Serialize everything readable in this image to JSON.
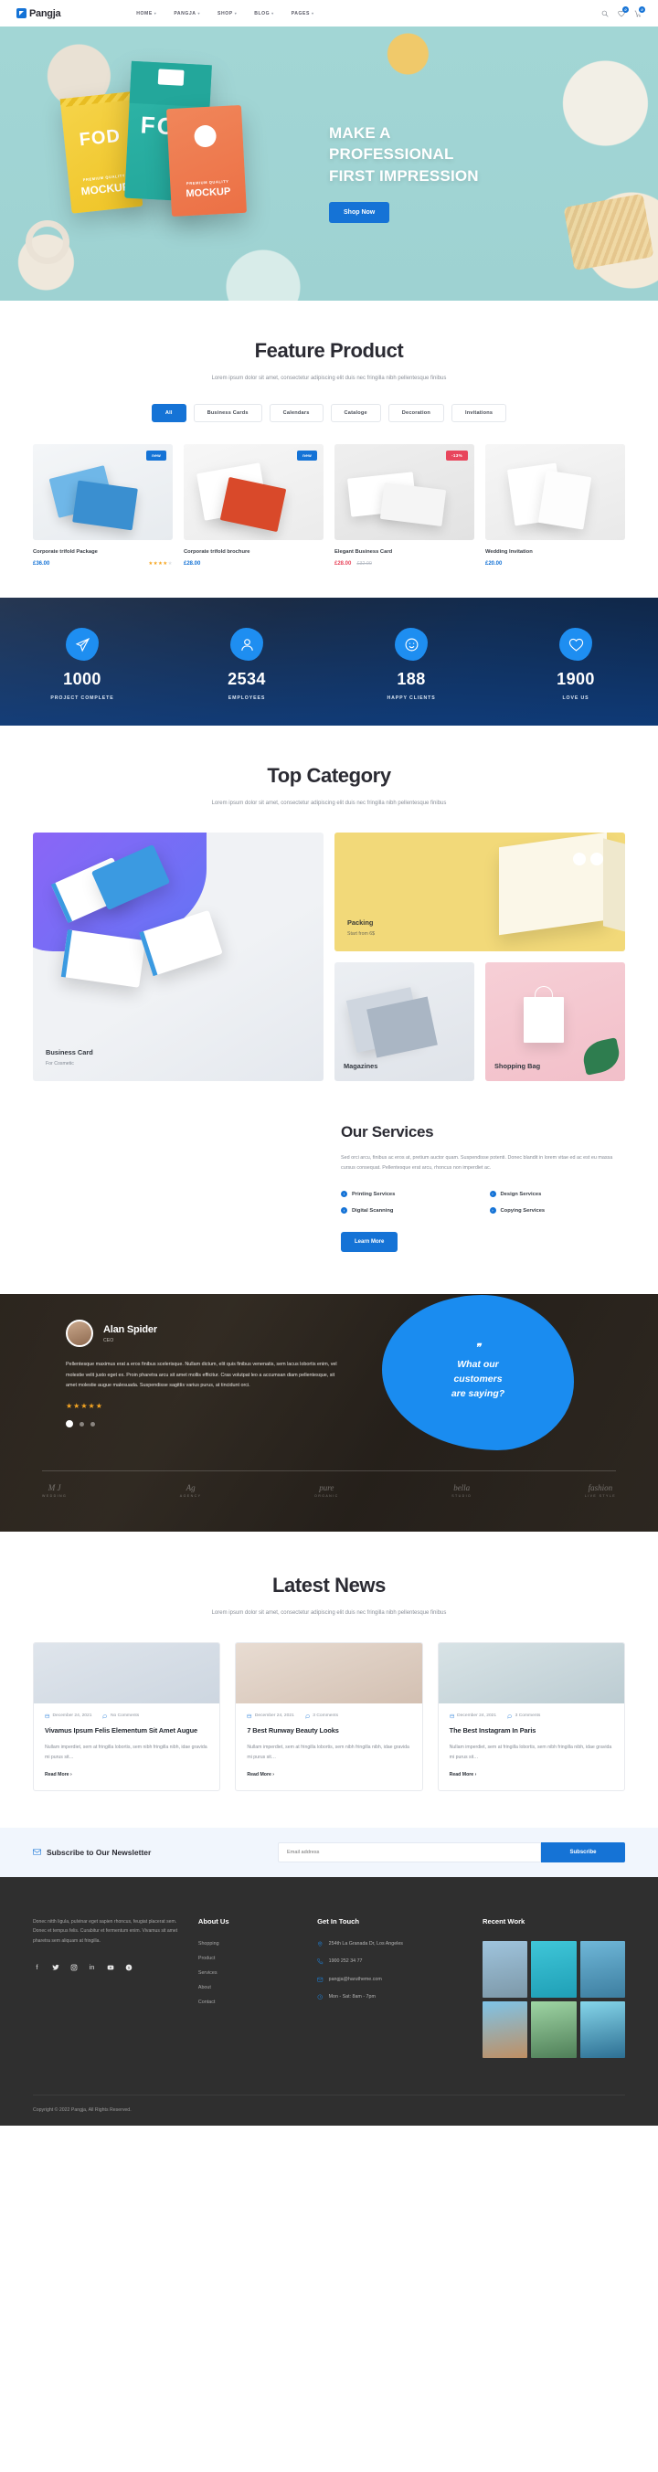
{
  "header": {
    "brand": "Pangja",
    "nav": [
      {
        "label": "HOME",
        "caret": "▾"
      },
      {
        "label": "PANGJA",
        "caret": "▾"
      },
      {
        "label": "SHOP",
        "caret": "▾"
      },
      {
        "label": "BLOG",
        "caret": "▾"
      },
      {
        "label": "PAGES",
        "caret": "▾"
      }
    ],
    "icons": {
      "search": "search-icon",
      "wishlist": "heart-icon",
      "wishlist_count": "0",
      "cart": "cart-icon",
      "cart_count": "0"
    }
  },
  "hero": {
    "line1": "MAKE A",
    "line2": "PROFESSIONAL",
    "line3": "FIRST IMPRESSION",
    "cta": "Shop Now",
    "pack_left_label": "MOCKUP",
    "pack_left_sub": "PREMIUM QUALITY",
    "pack_left_word": "FOD",
    "pack_mid_word": "FOD",
    "pack_right_label": "MOCKUP",
    "pack_right_sub": "PREMIUM QUALITY"
  },
  "feature": {
    "title": "Feature Product",
    "subtitle": "Lorem ipsum dolor sit amet, consectetur adipiscing elit duis nec fringilla nibh pellentesque finibus",
    "filters": [
      "All",
      "Business Cards",
      "Calendars",
      "Cataloge",
      "Decoration",
      "Invitations"
    ],
    "active_filter": "All",
    "products": [
      {
        "name": "Corporate trifold Package",
        "price": "£36.00",
        "old_price": "",
        "badge": "new",
        "badge_type": "new",
        "rating": 4,
        "show_stars": true
      },
      {
        "name": "Corporate trifold brochure",
        "price": "£28.00",
        "old_price": "",
        "badge": "new",
        "badge_type": "new",
        "rating": 0,
        "show_stars": false
      },
      {
        "name": "Elegant Business Card",
        "price": "£28.00",
        "old_price": "£32.00",
        "badge": "-13%",
        "badge_type": "sale",
        "rating": 0,
        "show_stars": false
      },
      {
        "name": "Wedding Invitation",
        "price": "£20.00",
        "old_price": "",
        "badge": "",
        "badge_type": "",
        "rating": 0,
        "show_stars": false
      }
    ]
  },
  "counters": [
    {
      "icon": "plane-icon",
      "value": "1000",
      "label": "PROJECT COMPLETE"
    },
    {
      "icon": "user-icon",
      "value": "2534",
      "label": "EMPLOYEES"
    },
    {
      "icon": "smile-icon",
      "value": "188",
      "label": "HAPPY CLIENTS"
    },
    {
      "icon": "heart-icon",
      "value": "1900",
      "label": "LOVE US"
    }
  ],
  "category": {
    "title": "Top Category",
    "subtitle": "Lorem ipsum dolor sit amet, consectetur adipiscing elit duis nec fringilla nibh pellentesque finibus",
    "cards": [
      {
        "title": "Business Card",
        "sub": "For Cosmetic"
      },
      {
        "title": "Packing",
        "sub": "Start from 6$"
      },
      {
        "title": "Magazines",
        "sub": ""
      },
      {
        "title": "Shopping Bag",
        "sub": ""
      }
    ]
  },
  "services": {
    "title": "Our Services",
    "paragraph": "Sed orci arcu, finibus ac eros at, pretium auctor quam. Suspendisse potenti. Donec blandit in lorem vitae ed ac est eu massa cursus consequat. Pellentesque erat arcu, rhoncus non imperdiet ac.",
    "items": [
      "Printing Services",
      "Design Services",
      "Digital Scanning",
      "Copying Services"
    ],
    "cta": "Learn More"
  },
  "testimonial": {
    "name": "Alan Spider",
    "role": "CEO",
    "text": "Pellentesque maximus erat a eros finibus scelerisque. Nullam dictum, elit quis finibus venenatis, sem lacus lobortis enim, vel molestie velit justo eget ex. Proin pharetra arcu sit amet mollis efficitur. Cras volutpat leo a accumsan diam pellentesque, sit amet molestie augue malesuada. Suspendisse sagittis varius purus, at tincidunt orci.",
    "stars": "★★★★★",
    "quote_mark": "\"",
    "blob_line1": "What our",
    "blob_line2": "customers",
    "blob_line3": "are saying?",
    "brands": [
      {
        "main": "M J",
        "sub": "WEDDING"
      },
      {
        "main": "Ag",
        "sub": "AGENCY"
      },
      {
        "main": "pure",
        "sub": "ORGANIC"
      },
      {
        "main": "bella",
        "sub": "STUDIO"
      },
      {
        "main": "fashion",
        "sub": "LIVE STYLE"
      }
    ]
  },
  "news": {
    "title": "Latest News",
    "subtitle": "Lorem ipsum dolor sit amet, consectetur adipiscing elit duis nec fringilla nibh pellentesque finibus",
    "posts": [
      {
        "date": "December 24, 2021",
        "comments": "No Comments",
        "title": "Vivamus Ipsum Felis Elementum Sit Amet Augue",
        "excerpt": "Nullam imperdiet, sem at fringilla lobortis, sem nibh fringilla nibh, idae gravida mi purus sit…",
        "more": "Read More ›"
      },
      {
        "date": "December 24, 2021",
        "comments": "3 Comments",
        "title": "7 Best Runway Beauty Looks",
        "excerpt": "Nullam imperdiet, sem at fringilla lobortis, sem nibh fringilla nibh, idae gravida mi purus sit…",
        "more": "Read More ›"
      },
      {
        "date": "December 24, 2021",
        "comments": "3 Comments",
        "title": "The Best Instagram In Paris",
        "excerpt": "Nullam imperdiet, sem at fringilla lobortis, sem nibh fringilla nibh, idae gravida mi purus sit…",
        "more": "Read More ›"
      }
    ]
  },
  "newsletter": {
    "title": "Subscribe to Our Newsletter",
    "placeholder": "Email address",
    "button": "Subscribe"
  },
  "footer": {
    "description": "Donec nitth ligula, pulvinar eget sapien rhoncus, feugiat placerat sem. Donec et tempus felis. Curabitur et fermentum enim. Vivamus sit amet pharetra sem aliquam at fringilla.",
    "social": [
      "facebook-icon",
      "twitter-icon",
      "instagram-icon",
      "linkedin-icon",
      "youtube-icon",
      "skype-icon"
    ],
    "about_heading": "About Us",
    "about_links": [
      "Shopping",
      "Product",
      "Services",
      "About",
      "Contact"
    ],
    "contact_heading": "Get In Touch",
    "contacts": [
      {
        "icon": "location-icon",
        "text": "254th La Granada Dr, Los Angeles"
      },
      {
        "icon": "phone-icon",
        "text": "1900 252 34 77"
      },
      {
        "icon": "mail-icon",
        "text": "pangja@harutheme.com"
      },
      {
        "icon": "clock-icon",
        "text": "Mon - Sat: 8am - 7pm"
      }
    ],
    "work_heading": "Recent Work",
    "copyright": "Copyright © 2022 Pangja, All Rights Reserved."
  },
  "colors": {
    "accent": "#1573d6",
    "accent_light": "#1a8cf0",
    "sale": "#e8465c",
    "star": "#f6a623",
    "hero_bg": "#9ed4d4",
    "footer_bg": "#2f2f2f"
  }
}
